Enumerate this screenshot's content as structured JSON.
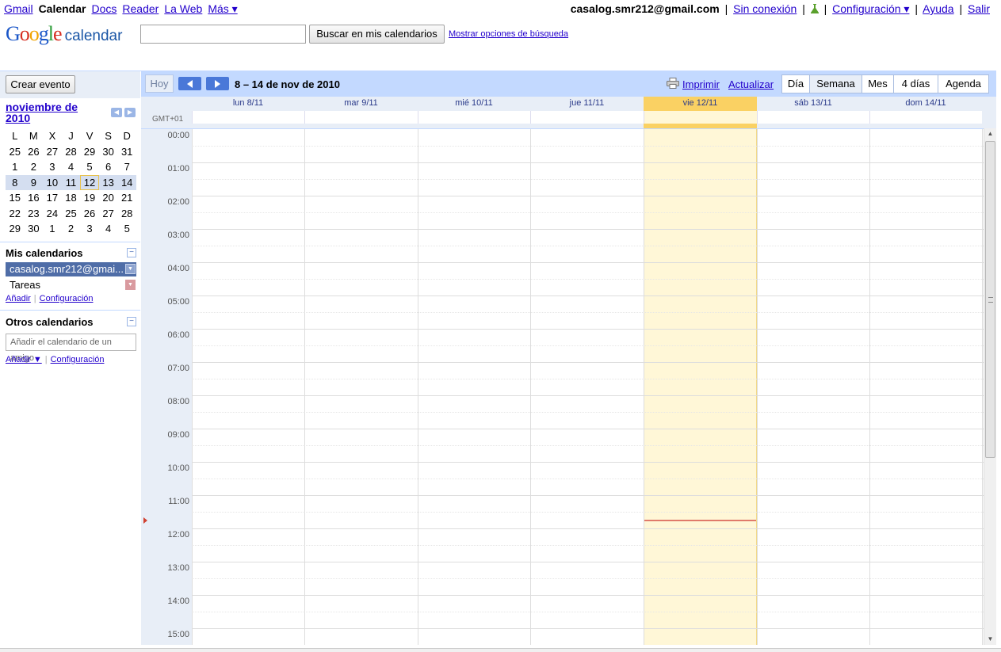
{
  "topbar": {
    "apps": [
      {
        "label": "Gmail",
        "current": false
      },
      {
        "label": "Calendar",
        "current": true
      },
      {
        "label": "Docs",
        "current": false
      },
      {
        "label": "Reader",
        "current": false
      },
      {
        "label": "La Web",
        "current": false
      },
      {
        "label": "Más ▾",
        "current": false
      }
    ],
    "email": "casalog.smr212@gmail.com",
    "offline": "Sin conexión",
    "settings": "Configuración ▾",
    "help": "Ayuda",
    "signout": "Salir",
    "separator": "|"
  },
  "header": {
    "logo_google": "Google",
    "logo_product": "calendar",
    "search_value": "",
    "search_button": "Buscar en mis calendarios",
    "search_options": "Mostrar opciones de búsqueda"
  },
  "sidebar": {
    "create_event": "Crear evento",
    "mini_cal": {
      "title": "noviembre de 2010",
      "weekdays": [
        "L",
        "M",
        "X",
        "J",
        "V",
        "S",
        "D"
      ],
      "weeks": [
        [
          "25",
          "26",
          "27",
          "28",
          "29",
          "30",
          "31"
        ],
        [
          "1",
          "2",
          "3",
          "4",
          "5",
          "6",
          "7"
        ],
        [
          "8",
          "9",
          "10",
          "11",
          "12",
          "13",
          "14"
        ],
        [
          "15",
          "16",
          "17",
          "18",
          "19",
          "20",
          "21"
        ],
        [
          "22",
          "23",
          "24",
          "25",
          "26",
          "27",
          "28"
        ],
        [
          "29",
          "30",
          "1",
          "2",
          "3",
          "4",
          "5"
        ]
      ],
      "selected_week_index": 2,
      "today": "12"
    },
    "my_calendars": {
      "title": "Mis calendarios",
      "collapse": "−",
      "items": [
        "casalog.smr212@gmai...",
        "Tareas"
      ],
      "add": "Añadir",
      "config": "Configuración"
    },
    "other_calendars": {
      "title": "Otros calendarios",
      "collapse": "−",
      "placeholder": "Añadir el calendario de un amigo",
      "add": "Añadir ▼",
      "config": "Configuración"
    }
  },
  "toolbar": {
    "today": "Hoy",
    "date_range": "8 – 14 de nov de 2010",
    "print": "Imprimir",
    "refresh": "Actualizar",
    "views": [
      {
        "label": "Día",
        "active": false
      },
      {
        "label": "Semana",
        "active": true
      },
      {
        "label": "Mes",
        "active": false
      },
      {
        "label": "4 días",
        "active": false
      },
      {
        "label": "Agenda",
        "active": false
      }
    ]
  },
  "week": {
    "timezone": "GMT+01",
    "days": [
      {
        "label": "lun 8/11",
        "today": false
      },
      {
        "label": "mar 9/11",
        "today": false
      },
      {
        "label": "mié 10/11",
        "today": false
      },
      {
        "label": "jue 11/11",
        "today": false
      },
      {
        "label": "vie 12/11",
        "today": true
      },
      {
        "label": "sáb 13/11",
        "today": false
      },
      {
        "label": "dom 14/11",
        "today": false
      }
    ],
    "hours": [
      "00:00",
      "01:00",
      "02:00",
      "03:00",
      "04:00",
      "05:00",
      "06:00",
      "07:00",
      "08:00",
      "09:00",
      "10:00",
      "11:00",
      "12:00",
      "13:00",
      "14:00",
      "15:00"
    ],
    "current_time": "11:45"
  },
  "colors": {
    "accent": "#c3d9ff",
    "panel": "#e8eef7",
    "today_header": "#fad163",
    "today_bg": "#fff7d7",
    "calendar_main": "#4f6da7",
    "calendar_tasks": "#d99a9f",
    "now_line": "#e07a6a"
  }
}
